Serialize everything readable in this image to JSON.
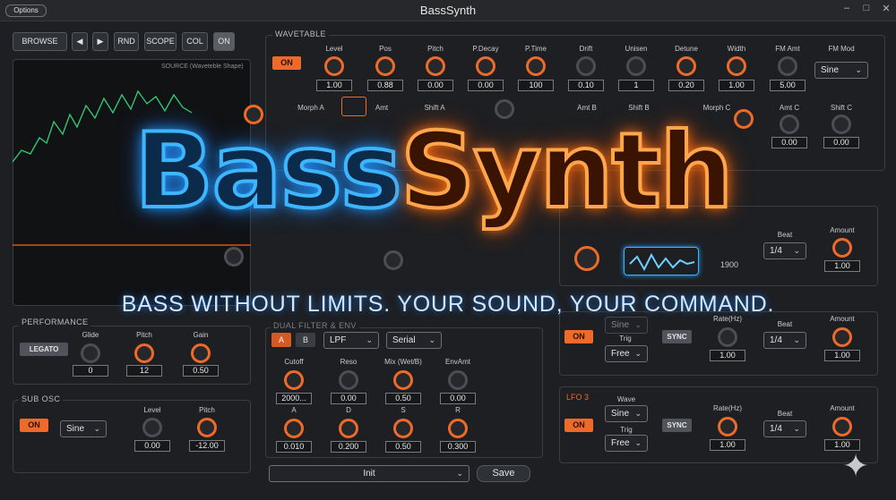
{
  "window": {
    "title": "BassSynth",
    "options_label": "Options"
  },
  "toolbar": {
    "browse": "BROWSE",
    "prev": "◀",
    "next": "▶",
    "rnd": "RND",
    "scope": "SCOPE",
    "col": "COL",
    "on": "ON"
  },
  "source": {
    "label": "SOURCE (Waveteble Shape)"
  },
  "wavetable": {
    "title": "WAVETABLE",
    "on": "ON",
    "params": [
      {
        "label": "Level",
        "value": "1.00"
      },
      {
        "label": "Pos",
        "value": "0.88"
      },
      {
        "label": "Pitch",
        "value": "0.00"
      },
      {
        "label": "P.Decay",
        "value": "0.00"
      },
      {
        "label": "P.Time",
        "value": "100"
      },
      {
        "label": "Drift",
        "value": "0.10"
      },
      {
        "label": "Unisen",
        "value": "1"
      },
      {
        "label": "Detune",
        "value": "0.20"
      },
      {
        "label": "Width",
        "value": "1.00"
      },
      {
        "label": "FM Amt",
        "value": "5.00"
      }
    ],
    "fm_mod_label": "FM Mod",
    "fm_mod_value": "Sine",
    "row2": {
      "morph_a": "Morph A",
      "amt": "Amt",
      "shift": "Shift A",
      "amt_b": "Amt B",
      "shift_b": "Shift B",
      "morph_c": "Morph C",
      "amt_c": "Amt C",
      "amt_c_value": "0.00",
      "shift_c": "Shift C",
      "shift_c_value": "0.00"
    }
  },
  "logo": {
    "part1": "Bass",
    "part2": "Synth"
  },
  "tagline": "BASS WITHOUT LIMITS. YOUR SOUND, YOUR COMMAND.",
  "lfo_top": {
    "beat_label": "Beat",
    "beat_value": "1/4",
    "amount_label": "Amount",
    "amount_value": "1.00",
    "field": "1900"
  },
  "performance": {
    "title": "PERFORMANCE",
    "legato": "LEGATO",
    "glide_label": "Glide",
    "glide_value": "0",
    "pitch_label": "Pitch",
    "pitch_value": "12",
    "gain_label": "Gain",
    "gain_value": "0.50"
  },
  "sub_osc": {
    "title": "SUB OSC",
    "on": "ON",
    "wave": "Sine",
    "level_label": "Level",
    "level_value": "0.00",
    "pitch_label": "Pitch",
    "pitch_value": "-12.00"
  },
  "filter": {
    "title": "DUAL FILTER & ENV",
    "tab_a": "A",
    "tab_b": "B",
    "type": "LPF",
    "routing": "Serial",
    "row1": [
      {
        "label": "Cutoff",
        "value": "2000..."
      },
      {
        "label": "Reso",
        "value": "0.00"
      },
      {
        "label": "Mix (Wet/B)",
        "value": "0.50"
      },
      {
        "label": "EnvAmt",
        "value": "0.00"
      }
    ],
    "row2": [
      {
        "label": "A",
        "value": "0.010"
      },
      {
        "label": "D",
        "value": "0.200"
      },
      {
        "label": "S",
        "value": "0.50"
      },
      {
        "label": "R",
        "value": "0.300"
      }
    ]
  },
  "lfo2": {
    "wave": "Sine",
    "on": "ON",
    "trig_label": "Trig",
    "trig_value": "Free",
    "sync": "SYNC",
    "rate_label": "Rate(Hz)",
    "rate_value": "1.00",
    "beat_label": "Beat",
    "beat_value": "1/4",
    "amount_label": "Amount",
    "amount_value": "1.00"
  },
  "lfo3": {
    "title": "LFO 3",
    "on": "ON",
    "wave_label": "Wave",
    "wave_value": "Sine",
    "trig_label": "Trig",
    "trig_value": "Free",
    "sync": "SYNC",
    "rate_label": "Rate(Hz)",
    "rate_value": "1.00",
    "beat_label": "Beat",
    "beat_value": "1/4",
    "amount_label": "Amount",
    "amount_value": "1.00"
  },
  "footer": {
    "preset": "Init",
    "save": "Save"
  },
  "colors": {
    "accent": "#ee6a28",
    "logo_blue": "#3cb6ff",
    "logo_orange": "#ffa64a"
  }
}
